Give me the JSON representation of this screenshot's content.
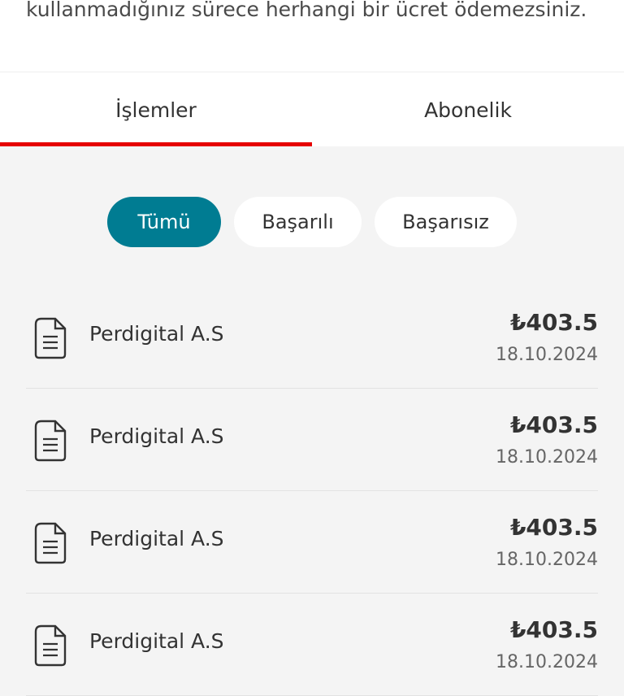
{
  "header": {
    "info_text": "kullanmadığınız sürece herhangi bir ücret ödemezsiniz."
  },
  "tabs": [
    {
      "label": "İşlemler",
      "active": true
    },
    {
      "label": "Abonelik",
      "active": false
    }
  ],
  "filters": [
    {
      "label": "Tümü",
      "selected": true
    },
    {
      "label": "Başarılı",
      "selected": false
    },
    {
      "label": "Başarısız",
      "selected": false
    }
  ],
  "transactions": [
    {
      "icon": "document-icon",
      "merchant": "Perdigital A.S",
      "amount": "₺403.5",
      "date": "18.10.2024"
    },
    {
      "icon": "document-icon",
      "merchant": "Perdigital A.S",
      "amount": "₺403.5",
      "date": "18.10.2024"
    },
    {
      "icon": "document-icon",
      "merchant": "Perdigital A.S",
      "amount": "₺403.5",
      "date": "18.10.2024"
    },
    {
      "icon": "document-icon",
      "merchant": "Perdigital A.S",
      "amount": "₺403.5",
      "date": "18.10.2024"
    }
  ],
  "colors": {
    "accent_red": "#e60000",
    "chip_selected": "#007c92",
    "background": "#f4f4f4"
  }
}
